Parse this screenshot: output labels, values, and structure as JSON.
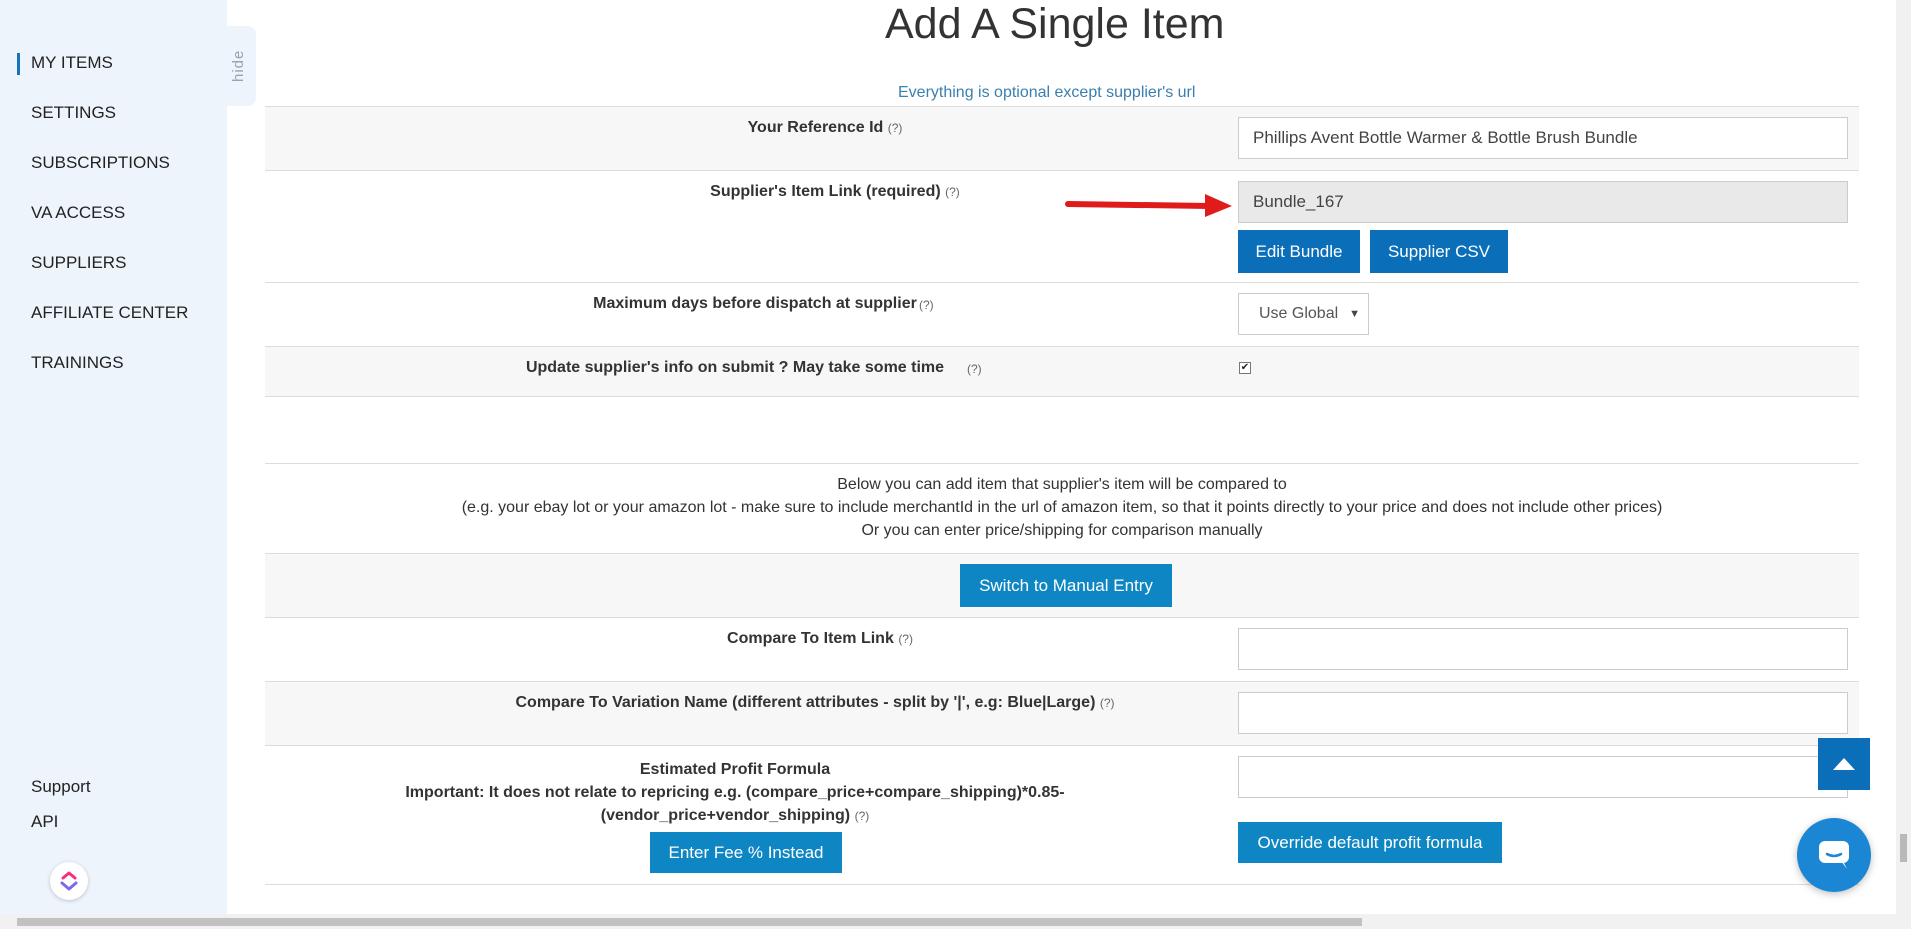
{
  "sidebar": {
    "items": [
      {
        "label": "MY ITEMS"
      },
      {
        "label": "SETTINGS"
      },
      {
        "label": "SUBSCRIPTIONS"
      },
      {
        "label": "VA ACCESS"
      },
      {
        "label": "SUPPLIERS"
      },
      {
        "label": "AFFILIATE CENTER"
      },
      {
        "label": "TRAININGS"
      }
    ],
    "hide_label": "hide",
    "support_label": "Support",
    "api_label": "API",
    "logo_icon": "clickup-logo-icon"
  },
  "page": {
    "title": "Add A Single Item",
    "subtitle": "Everything is optional except supplier's url",
    "help_marker": "(?)"
  },
  "form": {
    "reference_id": {
      "label": "Your Reference Id",
      "value": "Phillips Avent Bottle Warmer & Bottle Brush Bundle"
    },
    "supplier_link": {
      "label": "Supplier's Item Link (required)",
      "value": "Bundle_167",
      "edit_bundle_label": "Edit Bundle",
      "supplier_csv_label": "Supplier CSV"
    },
    "max_days": {
      "label": "Maximum days before dispatch at supplier",
      "selected": "Use Global"
    },
    "update_info": {
      "label": "Update supplier's info on submit ? May take some time",
      "checked": true
    },
    "compare_info": {
      "line1": "Below you can add item that supplier's item will be compared to",
      "line2": "(e.g. your ebay lot or your amazon lot - make sure to include merchantId in the url of amazon item, so that it points directly to your price and does not include other prices)",
      "line3": "Or you can enter price/shipping for comparison manually"
    },
    "manual_entry_label": "Switch to Manual Entry",
    "compare_link": {
      "label": "Compare To Item Link",
      "value": ""
    },
    "compare_variation": {
      "label": "Compare To Variation Name (different attributes - split by '|', e.g: Blue|Large)",
      "value": ""
    },
    "profit_formula": {
      "title": "Estimated Profit Formula",
      "note_line1": "Important: It does not relate to repricing e.g. (compare_price+compare_shipping)*0.85-",
      "note_line2": "(vendor_price+vendor_shipping)",
      "value": "",
      "fee_button_label": "Enter Fee % Instead",
      "override_button_label": "Override default profit formula"
    }
  },
  "colors": {
    "primary_button": "#0e86c4",
    "dark_button": "#0a6fb8",
    "sidebar_bg": "#edf4fb",
    "arrow": "#e01b1b"
  }
}
